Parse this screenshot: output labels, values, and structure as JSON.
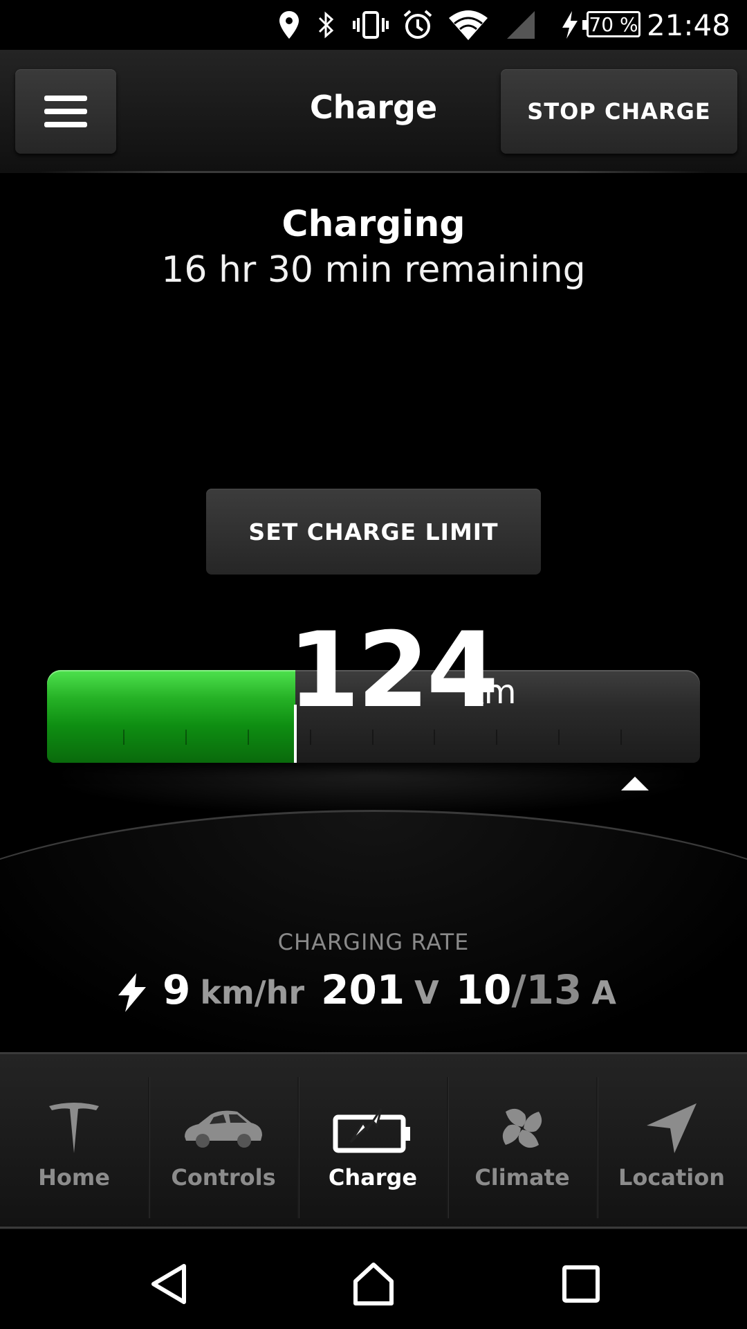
{
  "status_bar": {
    "time": "21:48",
    "battery_percent": "70 %",
    "icons": [
      "location-icon",
      "bluetooth-icon",
      "vibrate-icon",
      "alarm-icon",
      "wifi-icon",
      "cell-signal-icon",
      "charging-bolt-icon",
      "battery-icon"
    ]
  },
  "header": {
    "title": "Charge",
    "menu_icon": "hamburger-menu-icon",
    "stop_label": "STOP CHARGE"
  },
  "status": {
    "title": "Charging",
    "remaining": "16 hr 30 min remaining"
  },
  "set_limit_label": "SET CHARGE LIMIT",
  "battery": {
    "range_value": "124",
    "range_unit": "km",
    "fill_fraction": 0.38,
    "charge_limit_fraction": 0.9,
    "fill_color": "#1fae1f"
  },
  "charging_rate": {
    "label": "CHARGING RATE",
    "speed": "9",
    "speed_unit": "km/hr",
    "voltage": "201",
    "voltage_unit": "V",
    "current": "10",
    "current_max": "/13",
    "current_unit": "A"
  },
  "tabs": [
    {
      "label": "Home",
      "icon": "tesla-logo-icon",
      "active": false
    },
    {
      "label": "Controls",
      "icon": "car-icon",
      "active": false
    },
    {
      "label": "Charge",
      "icon": "battery-charge-icon",
      "active": true
    },
    {
      "label": "Climate",
      "icon": "fan-icon",
      "active": false
    },
    {
      "label": "Location",
      "icon": "navigation-arrow-icon",
      "active": false
    }
  ],
  "nav": {
    "back_icon": "back-triangle-icon",
    "home_icon": "home-icon",
    "recents_icon": "recents-square-icon"
  }
}
